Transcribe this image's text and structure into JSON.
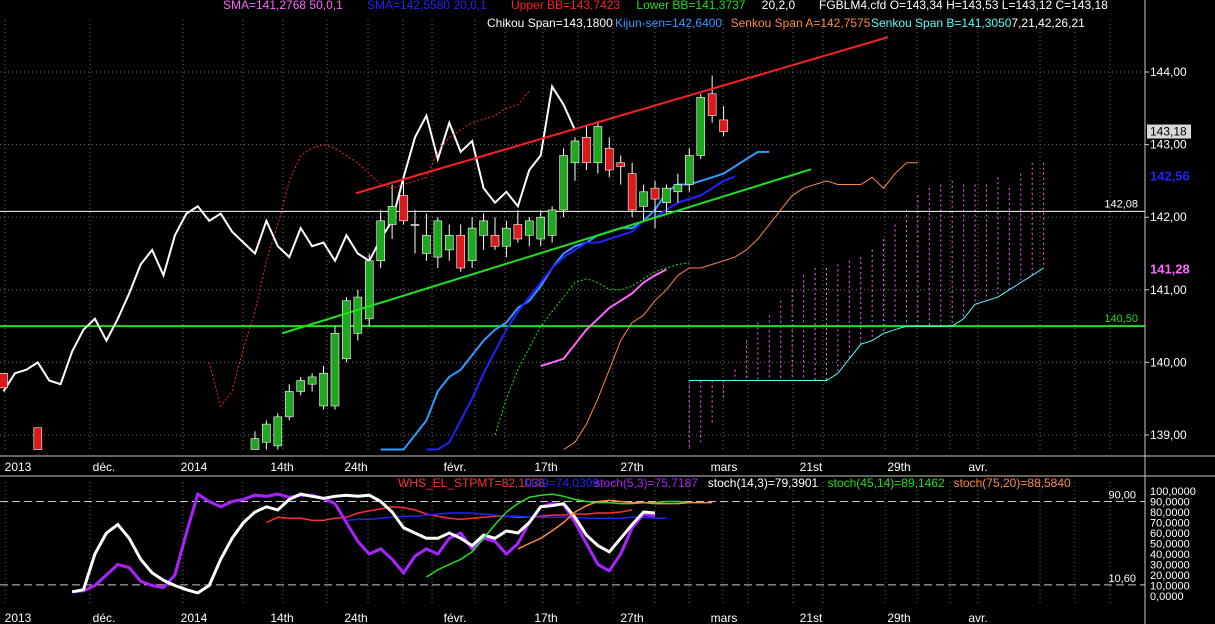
{
  "header": {
    "line1_segments": [
      {
        "text": "SMA=141,2768  50,0,1",
        "color": "#ff66ff"
      },
      {
        "text": "SMA=142,5580  20,0,1",
        "color": "#2222ff"
      },
      {
        "text": "Upper BB=143,7423",
        "color": "#ff2020"
      },
      {
        "text": "Lower BB=141,3737",
        "color": "#20e020"
      },
      {
        "text": "20,2,0",
        "color": "#ffffff"
      },
      {
        "text": "FGBLM4.cfd O=143,34 H=143,53 L=143,12 C=143,18",
        "color": "#ffffff"
      }
    ],
    "line2_segments": [
      {
        "text": "Chikou Span=143,1800",
        "color": "#ffffff"
      },
      {
        "text": "Kijun-sen=142,6400",
        "color": "#3399ff"
      },
      {
        "text": "Senkou Span A=142,7575",
        "color": "#ff8844"
      },
      {
        "text": "Senkou Span B=141,3050",
        "color": "#55ffff"
      },
      {
        "text": "7,21,42,26,21",
        "color": "#ffffff"
      }
    ]
  },
  "price_axis": {
    "ticks": [
      "144,00",
      "143,00",
      "142,00",
      "141,00",
      "140,00",
      "139,00"
    ],
    "tick_values": [
      144,
      143,
      142,
      141,
      140,
      139
    ],
    "last_close_label": "143,18",
    "sma20_label": "142,56",
    "sma50_label": "141,28",
    "level_labels": [
      "142,08",
      "140,50"
    ]
  },
  "time_axis": {
    "labels": [
      "2013",
      "déc.",
      "2014",
      "14th",
      "24th",
      "févr.",
      "17th",
      "27th",
      "mars",
      "21st",
      "29th",
      "avr."
    ]
  },
  "oscillator": {
    "header_segments": [
      {
        "text": "WHS_EL_STPMT=82,1038",
        "color": "#ff3030"
      },
      {
        "text": "MA9=74,0309",
        "color": "#2222ff"
      },
      {
        "text": "stoch(5,3)=75,7187",
        "color": "#aa22ff"
      },
      {
        "text": "stoch(14,3)=79,3901",
        "color": "#ffffff"
      },
      {
        "text": "stoch(45,14)=89,1462",
        "color": "#20e020"
      },
      {
        "text": "stoch(75,20)=88,5840",
        "color": "#ff8844"
      }
    ],
    "ticks": [
      "100,0000",
      "90,0000",
      "80,0000",
      "70,0000",
      "60,0000",
      "50,0000",
      "40,0000",
      "30,0000",
      "20,0000",
      "10,0000",
      "0,0000"
    ],
    "tick_values": [
      100,
      90,
      80,
      70,
      60,
      50,
      40,
      30,
      20,
      10,
      0
    ],
    "level_labels": [
      "90,00",
      "10,60"
    ]
  },
  "chart_data": [
    {
      "type": "candlestick",
      "symbol": "FGBLM4.cfd",
      "ylim": [
        138.8,
        144.8
      ],
      "horizontal_levels": [
        142.08,
        140.5
      ],
      "trendlines": [
        {
          "color": "#ff2020",
          "from": [
            "24th",
            142.33
          ],
          "to": [
            "avr.",
            144.48
          ]
        },
        {
          "color": "#20e020",
          "from": [
            "14th",
            140.4
          ],
          "to": [
            "21st",
            142.66
          ]
        }
      ],
      "candles": [
        {
          "o": 139.85,
          "h": 139.85,
          "l": 139.65,
          "c": 139.65
        },
        {
          "o": 139.1,
          "h": 139.1,
          "l": 138.8,
          "c": 138.8
        },
        {
          "o": 138.8,
          "h": 139.05,
          "l": 138.8,
          "c": 138.95
        },
        {
          "o": 138.9,
          "h": 139.2,
          "l": 138.8,
          "c": 139.15
        },
        {
          "o": 138.85,
          "h": 139.3,
          "l": 138.8,
          "c": 139.25
        },
        {
          "o": 139.25,
          "h": 139.7,
          "l": 139.2,
          "c": 139.6
        },
        {
          "o": 139.6,
          "h": 139.8,
          "l": 139.55,
          "c": 139.75
        },
        {
          "o": 139.7,
          "h": 139.85,
          "l": 139.6,
          "c": 139.8
        },
        {
          "o": 139.4,
          "h": 139.95,
          "l": 139.35,
          "c": 139.85
        },
        {
          "o": 139.4,
          "h": 140.5,
          "l": 139.35,
          "c": 140.4
        },
        {
          "o": 140.05,
          "h": 140.9,
          "l": 140.0,
          "c": 140.85
        },
        {
          "o": 140.4,
          "h": 141.0,
          "l": 140.3,
          "c": 140.9
        },
        {
          "o": 140.6,
          "h": 141.5,
          "l": 140.5,
          "c": 141.4
        },
        {
          "o": 141.4,
          "h": 142.1,
          "l": 141.3,
          "c": 141.95
        },
        {
          "o": 141.9,
          "h": 142.45,
          "l": 141.7,
          "c": 142.15
        },
        {
          "o": 142.3,
          "h": 142.5,
          "l": 141.9,
          "c": 141.95
        },
        {
          "o": 141.9,
          "h": 142.1,
          "l": 141.5,
          "c": 141.9
        },
        {
          "o": 141.5,
          "h": 142.05,
          "l": 141.4,
          "c": 141.75
        },
        {
          "o": 141.45,
          "h": 142.0,
          "l": 141.3,
          "c": 141.95
        },
        {
          "o": 141.55,
          "h": 141.9,
          "l": 141.4,
          "c": 141.75
        },
        {
          "o": 141.75,
          "h": 141.9,
          "l": 141.25,
          "c": 141.3
        },
        {
          "o": 141.4,
          "h": 142.0,
          "l": 141.3,
          "c": 141.85
        },
        {
          "o": 141.75,
          "h": 142.05,
          "l": 141.55,
          "c": 141.95
        },
        {
          "o": 141.75,
          "h": 142.0,
          "l": 141.55,
          "c": 141.6
        },
        {
          "o": 141.6,
          "h": 141.95,
          "l": 141.45,
          "c": 141.85
        },
        {
          "o": 141.9,
          "h": 142.1,
          "l": 141.65,
          "c": 141.7
        },
        {
          "o": 141.75,
          "h": 142.0,
          "l": 141.6,
          "c": 141.95
        },
        {
          "o": 141.7,
          "h": 142.1,
          "l": 141.6,
          "c": 142.0
        },
        {
          "o": 141.75,
          "h": 142.15,
          "l": 141.65,
          "c": 142.1
        },
        {
          "o": 142.1,
          "h": 142.95,
          "l": 142.0,
          "c": 142.85
        },
        {
          "o": 142.75,
          "h": 143.1,
          "l": 142.5,
          "c": 143.05
        },
        {
          "o": 143.1,
          "h": 143.25,
          "l": 142.65,
          "c": 142.75
        },
        {
          "o": 142.75,
          "h": 143.3,
          "l": 142.6,
          "c": 143.25
        },
        {
          "o": 142.95,
          "h": 143.1,
          "l": 142.55,
          "c": 142.65
        },
        {
          "o": 142.75,
          "h": 142.85,
          "l": 142.45,
          "c": 142.7
        },
        {
          "o": 142.6,
          "h": 142.75,
          "l": 142.0,
          "c": 142.1
        },
        {
          "o": 142.15,
          "h": 142.45,
          "l": 141.95,
          "c": 142.35
        },
        {
          "o": 142.4,
          "h": 142.5,
          "l": 141.85,
          "c": 142.25
        },
        {
          "o": 142.2,
          "h": 142.45,
          "l": 142.05,
          "c": 142.4
        },
        {
          "o": 142.35,
          "h": 142.6,
          "l": 142.2,
          "c": 142.45
        },
        {
          "o": 142.45,
          "h": 142.95,
          "l": 142.35,
          "c": 142.85
        },
        {
          "o": 142.85,
          "h": 143.7,
          "l": 142.8,
          "c": 143.65
        },
        {
          "o": 143.7,
          "h": 143.95,
          "l": 143.3,
          "c": 143.4
        },
        {
          "o": 143.34,
          "h": 143.53,
          "l": 143.12,
          "c": 143.18
        }
      ],
      "series": [
        {
          "name": "Chikou Span",
          "color": "#ffffff",
          "values": [
            139.6,
            139.85,
            139.9,
            140.0,
            139.75,
            139.7,
            140.15,
            140.45,
            140.6,
            140.3,
            140.6,
            140.95,
            141.35,
            141.55,
            141.2,
            141.75,
            142.05,
            142.15,
            141.95,
            142.05,
            141.8,
            141.65,
            141.5,
            141.95,
            141.6,
            141.45,
            141.85,
            141.6,
            141.65,
            141.4,
            141.75,
            141.5,
            141.4,
            141.7,
            141.95,
            142.55,
            143.1,
            143.4,
            142.8,
            143.3,
            142.9,
            143.05,
            142.4,
            142.2,
            142.35,
            142.15,
            142.65,
            142.85,
            143.8,
            143.55,
            143.2
          ]
        },
        {
          "name": "Kijun-sen",
          "color": "#3399ff",
          "values": [
            138.8,
            138.8,
            138.8,
            139.0,
            139.2,
            139.6,
            139.8,
            139.9,
            140.1,
            140.3,
            140.45,
            140.55,
            140.75,
            140.85,
            141.05,
            141.3,
            141.5,
            141.6,
            141.65,
            141.75,
            141.8,
            141.85,
            141.85,
            141.95,
            142.1,
            142.35,
            142.45,
            142.45,
            142.5,
            142.55,
            142.6,
            142.7,
            142.8,
            142.9,
            142.9
          ]
        },
        {
          "name": "Senkou Span A",
          "color": "#ff8844",
          "values": [
            138.8,
            138.9,
            139.15,
            139.5,
            139.9,
            140.3,
            140.55,
            140.65,
            140.85,
            141.0,
            141.2,
            141.3,
            141.3,
            141.35,
            141.4,
            141.45,
            141.55,
            141.7,
            141.9,
            142.1,
            142.3,
            142.4,
            142.45,
            142.5,
            142.45,
            142.45,
            142.45,
            142.55,
            142.4,
            142.6,
            142.75,
            142.75
          ]
        },
        {
          "name": "Senkou Span B",
          "color": "#55ffff",
          "values": [
            139.75,
            139.75,
            139.75,
            139.75,
            139.75,
            139.75,
            139.75,
            139.75,
            139.75,
            139.75,
            139.75,
            139.75,
            139.75,
            139.85,
            140.05,
            140.25,
            140.3,
            140.4,
            140.45,
            140.5,
            140.5,
            140.5,
            140.5,
            140.5,
            140.6,
            140.8,
            140.85,
            140.9,
            141.0,
            141.1,
            141.2,
            141.3
          ]
        },
        {
          "name": "SMA 20",
          "color": "#2222ff",
          "values": [
            138.8,
            138.8,
            138.9,
            139.2,
            139.5,
            139.85,
            140.15,
            140.45,
            140.7,
            140.9,
            141.1,
            141.3,
            141.45,
            141.55,
            141.65,
            141.65,
            141.7,
            141.75,
            141.8,
            141.95,
            142.0,
            142.1,
            142.2,
            142.25,
            142.3,
            142.4,
            142.5,
            142.56
          ]
        },
        {
          "name": "SMA 50",
          "color": "#ff66ff",
          "values": [
            139.95,
            140.0,
            140.05,
            140.25,
            140.45,
            140.6,
            140.75,
            140.85,
            140.95,
            141.1,
            141.2,
            141.28
          ]
        },
        {
          "name": "Upper BB",
          "color": "#ff2020",
          "values": [
            140.0,
            139.4,
            139.6,
            140.2,
            140.7,
            141.4,
            141.9,
            142.5,
            142.85,
            142.95,
            143.0,
            142.95,
            142.85,
            142.75,
            142.6,
            142.45,
            142.4,
            142.45,
            142.5,
            142.55,
            142.9,
            143.1,
            143.2,
            143.3,
            143.35,
            143.4,
            143.5,
            143.55,
            143.74
          ]
        },
        {
          "name": "Lower BB",
          "color": "#20e020",
          "values": [
            139.0,
            139.5,
            139.9,
            140.2,
            140.5,
            140.7,
            140.9,
            141.1,
            141.15,
            141.1,
            141.0,
            141.0,
            141.05,
            141.15,
            141.25,
            141.3,
            141.35,
            141.37
          ]
        }
      ]
    },
    {
      "type": "line",
      "ylim": [
        0,
        100
      ],
      "horizontal_levels": [
        90,
        10.6
      ],
      "series": [
        {
          "name": "WHS_EL_STPMT",
          "color": "#ff3030",
          "values": [
            70,
            75,
            74,
            74,
            72,
            72,
            74,
            75,
            79,
            81,
            83,
            85,
            84,
            82,
            78,
            76,
            74,
            73,
            74,
            75,
            76,
            76,
            75,
            75,
            76,
            77,
            77,
            78,
            78,
            79,
            79,
            80,
            82
          ]
        },
        {
          "name": "MA9",
          "color": "#2222ff",
          "values": [
            72,
            73,
            73,
            74,
            75,
            76,
            76,
            77,
            78,
            79,
            79,
            79,
            78,
            77,
            76,
            76,
            75,
            75,
            75,
            75,
            75,
            74,
            74,
            74,
            74,
            75,
            75,
            74,
            74
          ]
        },
        {
          "name": "stoch(5,3)",
          "color": "#aa22ff",
          "values": [
            4,
            5,
            10,
            20,
            30,
            27,
            14,
            10,
            8,
            20,
            60,
            97,
            90,
            85,
            90,
            92,
            96,
            95,
            97,
            94,
            96,
            96,
            93,
            88,
            70,
            52,
            40,
            45,
            35,
            22,
            38,
            45,
            40,
            55,
            60,
            45,
            55,
            52,
            40,
            50,
            70,
            85,
            88,
            87,
            70,
            50,
            30,
            24,
            40,
            65,
            78,
            76
          ]
        },
        {
          "name": "stoch(14,3)",
          "color": "#ffffff",
          "values": [
            4,
            6,
            40,
            60,
            68,
            55,
            35,
            22,
            15,
            10,
            6,
            3,
            10,
            35,
            55,
            70,
            80,
            85,
            82,
            92,
            97,
            95,
            93,
            95,
            96,
            95,
            96,
            90,
            80,
            65,
            60,
            55,
            55,
            60,
            55,
            48,
            58,
            55,
            62,
            60,
            70,
            85,
            86,
            88,
            75,
            58,
            48,
            42,
            55,
            68,
            80,
            79
          ]
        },
        {
          "name": "stoch(45,14)",
          "color": "#20e020",
          "values": [
            18,
            25,
            30,
            35,
            42,
            55,
            68,
            80,
            88,
            94,
            96,
            97,
            95,
            92,
            90,
            89,
            89,
            88,
            88,
            89,
            89,
            90,
            90,
            89
          ]
        },
        {
          "name": "stoch(75,20)",
          "color": "#ff8844",
          "values": [
            45,
            50,
            55,
            62,
            70,
            80,
            86,
            90,
            91,
            90,
            89,
            89,
            88,
            88,
            88,
            89,
            89,
            89
          ]
        }
      ]
    }
  ]
}
